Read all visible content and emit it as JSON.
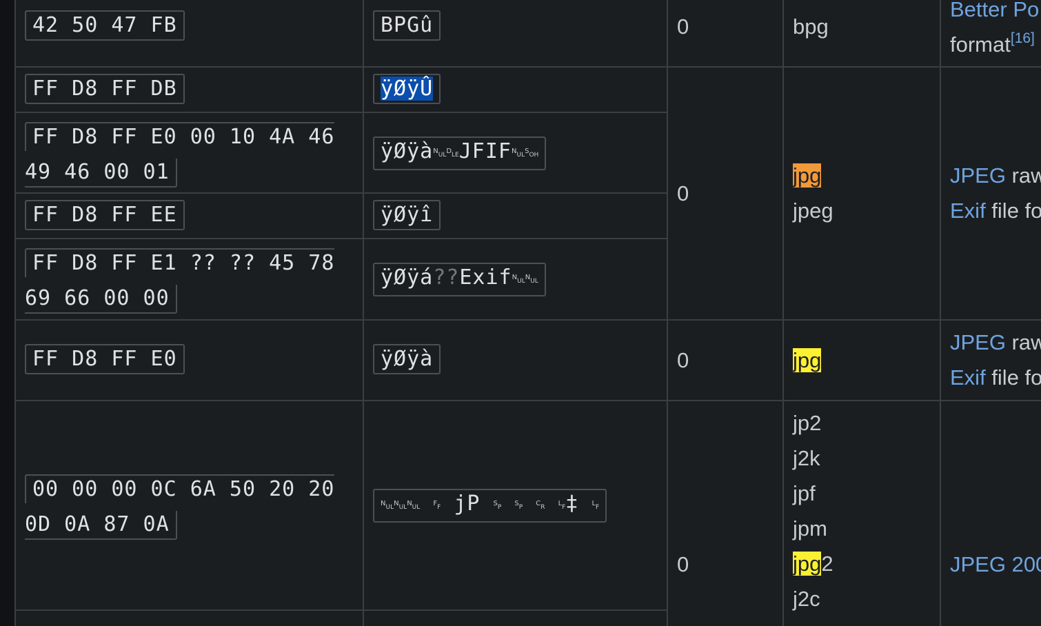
{
  "rows": {
    "bpg": {
      "hex": "42 50 47 FB",
      "iso": "BPGû",
      "offset": "0",
      "ext": "bpg",
      "desc_link": "Better Po",
      "desc_text": "format",
      "desc_ref": "[16]"
    },
    "jpeg_raw": {
      "hex_a": "FF D8 FF DB",
      "iso_a": "ÿØÿÛ",
      "hex_b1": "FF D8 FF E0 00 10 4A 46",
      "hex_b2": "49 46 00 01",
      "iso_b_prefix": "ÿØÿà",
      "iso_b_mid": "JFIF",
      "hex_c": "FF D8 FF EE",
      "iso_c": "ÿØÿî",
      "hex_d1": "FF D8 FF E1 ?? ?? 45 78",
      "hex_d2": "69 66 00 00",
      "iso_d_prefix": "ÿØÿá",
      "iso_d_q": "??",
      "iso_d_mid": "Exif",
      "offset": "0",
      "ext_1": "jpg",
      "ext_2": "jpeg",
      "desc_link1": "JPEG",
      "desc_text1": " raw",
      "desc_link2": "Exif",
      "desc_text2": " file fo"
    },
    "jpeg_jfif": {
      "hex": "FF D8 FF E0",
      "iso": "ÿØÿà",
      "offset": "0",
      "ext": "jpg",
      "desc_link1": "JPEG",
      "desc_text1": " raw",
      "desc_link2": "Exif",
      "desc_text2": " file fo"
    },
    "jpeg2000": {
      "hex1": "00 00 00 0C 6A 50 20 20",
      "hex2": "0D 0A 87 0A",
      "iso_mid": "jP",
      "iso_dagger": "‡",
      "offset": "0",
      "ext_1": "jp2",
      "ext_2": "j2k",
      "ext_3": "jpf",
      "ext_4": "jpm",
      "ext_5a": "jpg",
      "ext_5b": "2",
      "ext_6": "j2c",
      "desc_link": "JPEG 200"
    }
  },
  "control_chars": {
    "nul": [
      "N",
      "UL"
    ],
    "dle": [
      "D",
      "LE"
    ],
    "soh": [
      "S",
      "OH"
    ],
    "ff": [
      "F",
      "F"
    ],
    "sp": [
      "S",
      "P"
    ],
    "cr": [
      "C",
      "R"
    ],
    "lf": [
      "L",
      "F"
    ]
  },
  "colors": {
    "background": "#1b1e21",
    "grid": "#3a3f44",
    "link": "#6fa4e0",
    "highlight_current": "#f2993a",
    "highlight_match": "#fcf033",
    "selection": "#0b4fad"
  }
}
